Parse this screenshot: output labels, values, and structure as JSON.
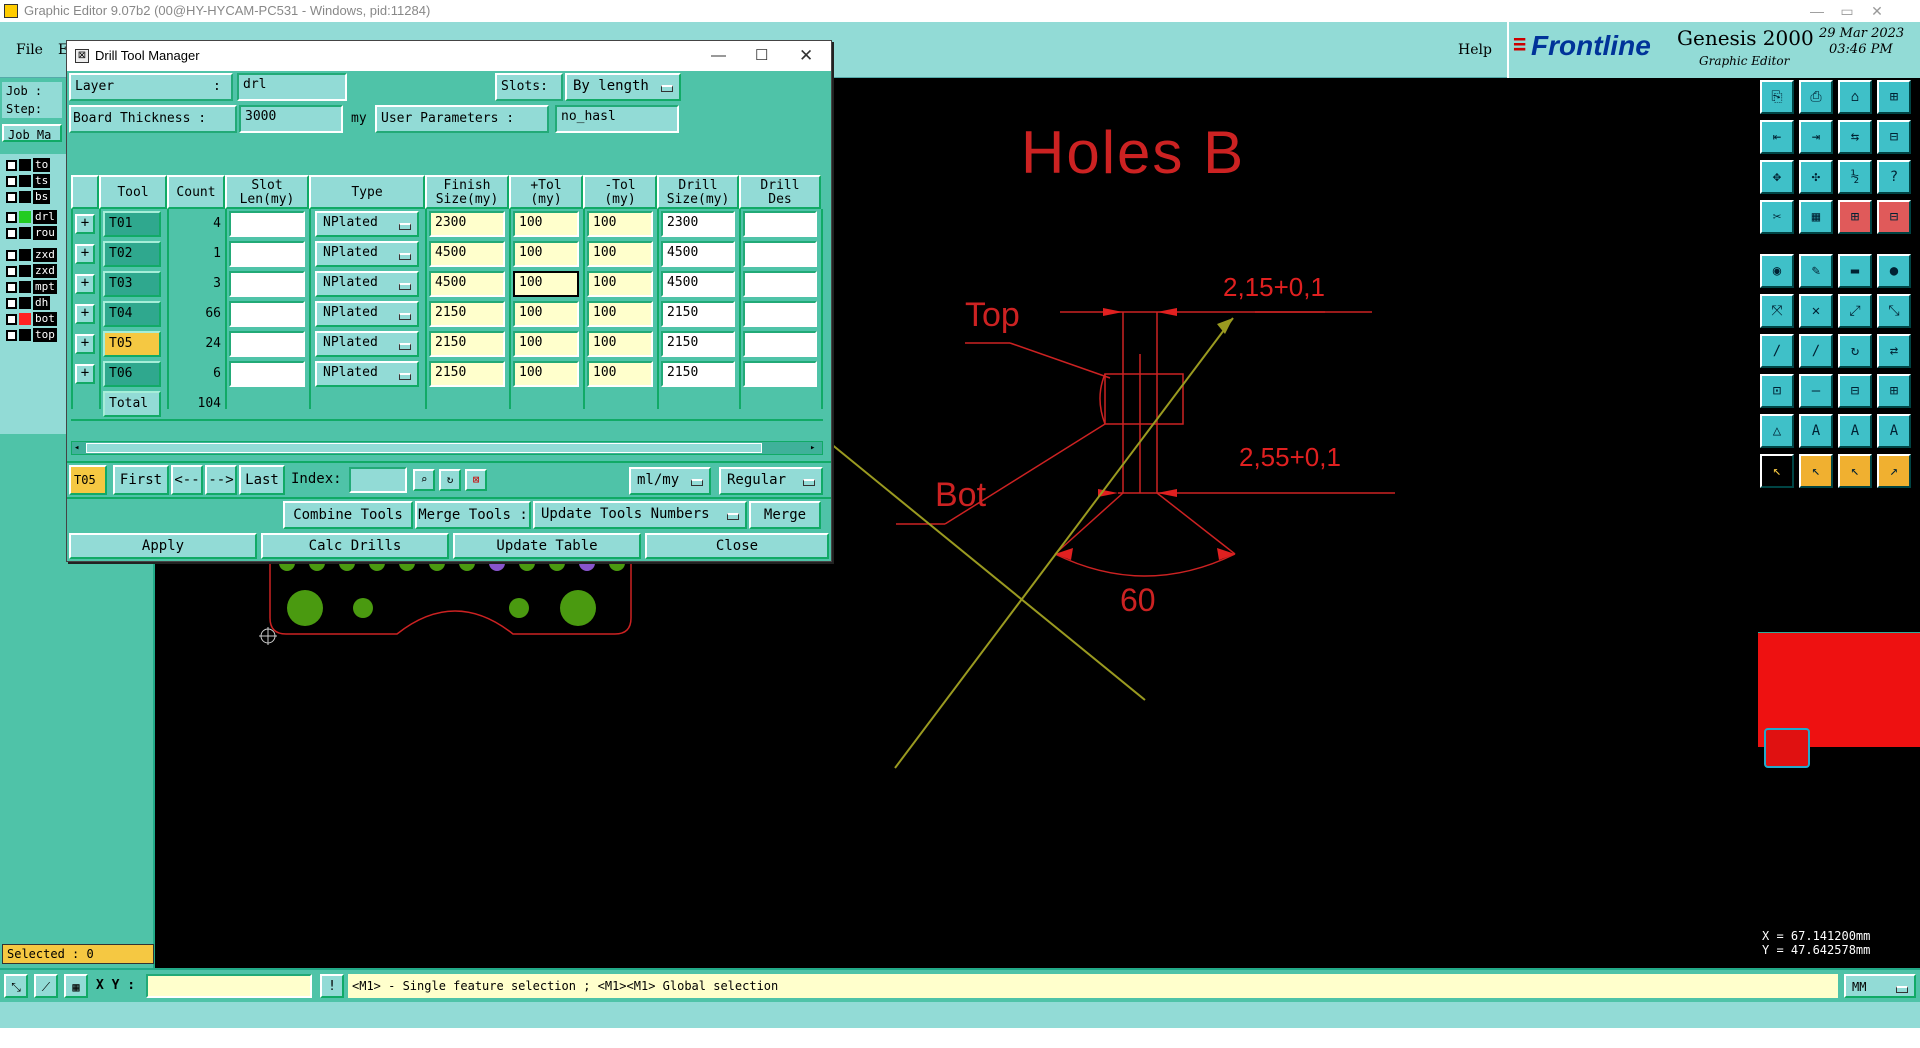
{
  "window": {
    "title": "Graphic Editor 9.07b2 (00@HY-HYCAM-PC531 - Windows, pid:11284)"
  },
  "menu": {
    "file": "File",
    "edit": "E",
    "help": "Help"
  },
  "brand": {
    "logo": "Frontline",
    "product": "Genesis 2000",
    "subtitle": "Graphic Editor",
    "date": "29 Mar 2023",
    "time": "03:46 PM"
  },
  "left_panel": {
    "job_label": "Job : ",
    "step_label": "Step: ",
    "job_matrix_label": "Job Ma",
    "layers": [
      {
        "name": "to",
        "color": "#000000"
      },
      {
        "name": "ts",
        "color": "#000000"
      },
      {
        "name": "bs",
        "color": "#000000"
      },
      {
        "name": "drl",
        "color": "#22cc22"
      },
      {
        "name": "rou",
        "color": "#000000"
      },
      {
        "name": "zxd",
        "color": "#000000"
      },
      {
        "name": "zxd",
        "color": "#000000"
      },
      {
        "name": "mpt",
        "color": "#000000"
      },
      {
        "name": "dh",
        "color": "#000000"
      },
      {
        "name": "bot",
        "color": "#ff2222"
      },
      {
        "name": "top",
        "color": "#000000"
      }
    ],
    "selected": "Selected : 0"
  },
  "dialog": {
    "title": "Drill Tool Manager",
    "layer_label": "Layer",
    "layer_colon": ":",
    "layer_value": "drl",
    "slots_label": "Slots:",
    "slots_value": "By length",
    "thickness_label": "Board Thickness :",
    "thickness_value": "3000",
    "thickness_unit": "my",
    "user_params_label": "User Parameters :",
    "user_params_value": "no_hasl",
    "headers": [
      "Tool",
      "Count",
      "Slot\nLen(my)",
      "Type",
      "Finish\nSize(my)",
      "+Tol\n(my)",
      "-Tol\n(my)",
      "Drill\nSize(my)",
      "Drill\nDes"
    ],
    "rows": [
      {
        "tool": "T01",
        "count": "4",
        "slot_len": "",
        "type": "NPlated",
        "finish": "2300",
        "ptol": "100",
        "mtol": "100",
        "drill": "2300",
        "des": ""
      },
      {
        "tool": "T02",
        "count": "1",
        "slot_len": "",
        "type": "NPlated",
        "finish": "4500",
        "ptol": "100",
        "mtol": "100",
        "drill": "4500",
        "des": ""
      },
      {
        "tool": "T03",
        "count": "3",
        "slot_len": "",
        "type": "NPlated",
        "finish": "4500",
        "ptol": "100",
        "mtol": "100",
        "drill": "4500",
        "des": ""
      },
      {
        "tool": "T04",
        "count": "66",
        "slot_len": "",
        "type": "NPlated",
        "finish": "2150",
        "ptol": "100",
        "mtol": "100",
        "drill": "2150",
        "des": ""
      },
      {
        "tool": "T05",
        "count": "24",
        "slot_len": "",
        "type": "NPlated",
        "finish": "2150",
        "ptol": "100",
        "mtol": "100",
        "drill": "2150",
        "des": ""
      },
      {
        "tool": "T06",
        "count": "6",
        "slot_len": "",
        "type": "NPlated",
        "finish": "2150",
        "ptol": "100",
        "mtol": "100",
        "drill": "2150",
        "des": ""
      }
    ],
    "total_label": "Total",
    "total_count": "104",
    "current_tool": "T05",
    "nav": {
      "first": "First",
      "prev": "<--",
      "next": "-->",
      "last": "Last",
      "index_label": "Index:",
      "index_value": ""
    },
    "units": "ml/my",
    "mode": "Regular",
    "combine": "Combine Tools",
    "merge_label": "Merge Tools :",
    "update_numbers": "Update Tools Numbers",
    "merge": "Merge",
    "apply": "Apply",
    "calc": "Calc Drills",
    "update_table": "Update Table",
    "close": "Close"
  },
  "drawing": {
    "title": "Holes B",
    "dim1": "2,15+0,1",
    "dim2": "2,55+0,1",
    "label_top": "Top",
    "label_bot": "Bot",
    "angle": "60"
  },
  "status": {
    "xy_label": "X Y :",
    "xy_value": "",
    "hint": "<M1> - Single feature selection ; <M1><M1> Global selection",
    "units": "MM",
    "x_coord": "X = 67.141200mm",
    "y_coord": "Y = 47.642578mm"
  },
  "colors": {
    "panel": "#4fc3a8",
    "panel_light": "#92dbd6",
    "drawing_red": "#e02020",
    "drill_green": "#4a9a10",
    "selected_tool": "#f5c842"
  }
}
